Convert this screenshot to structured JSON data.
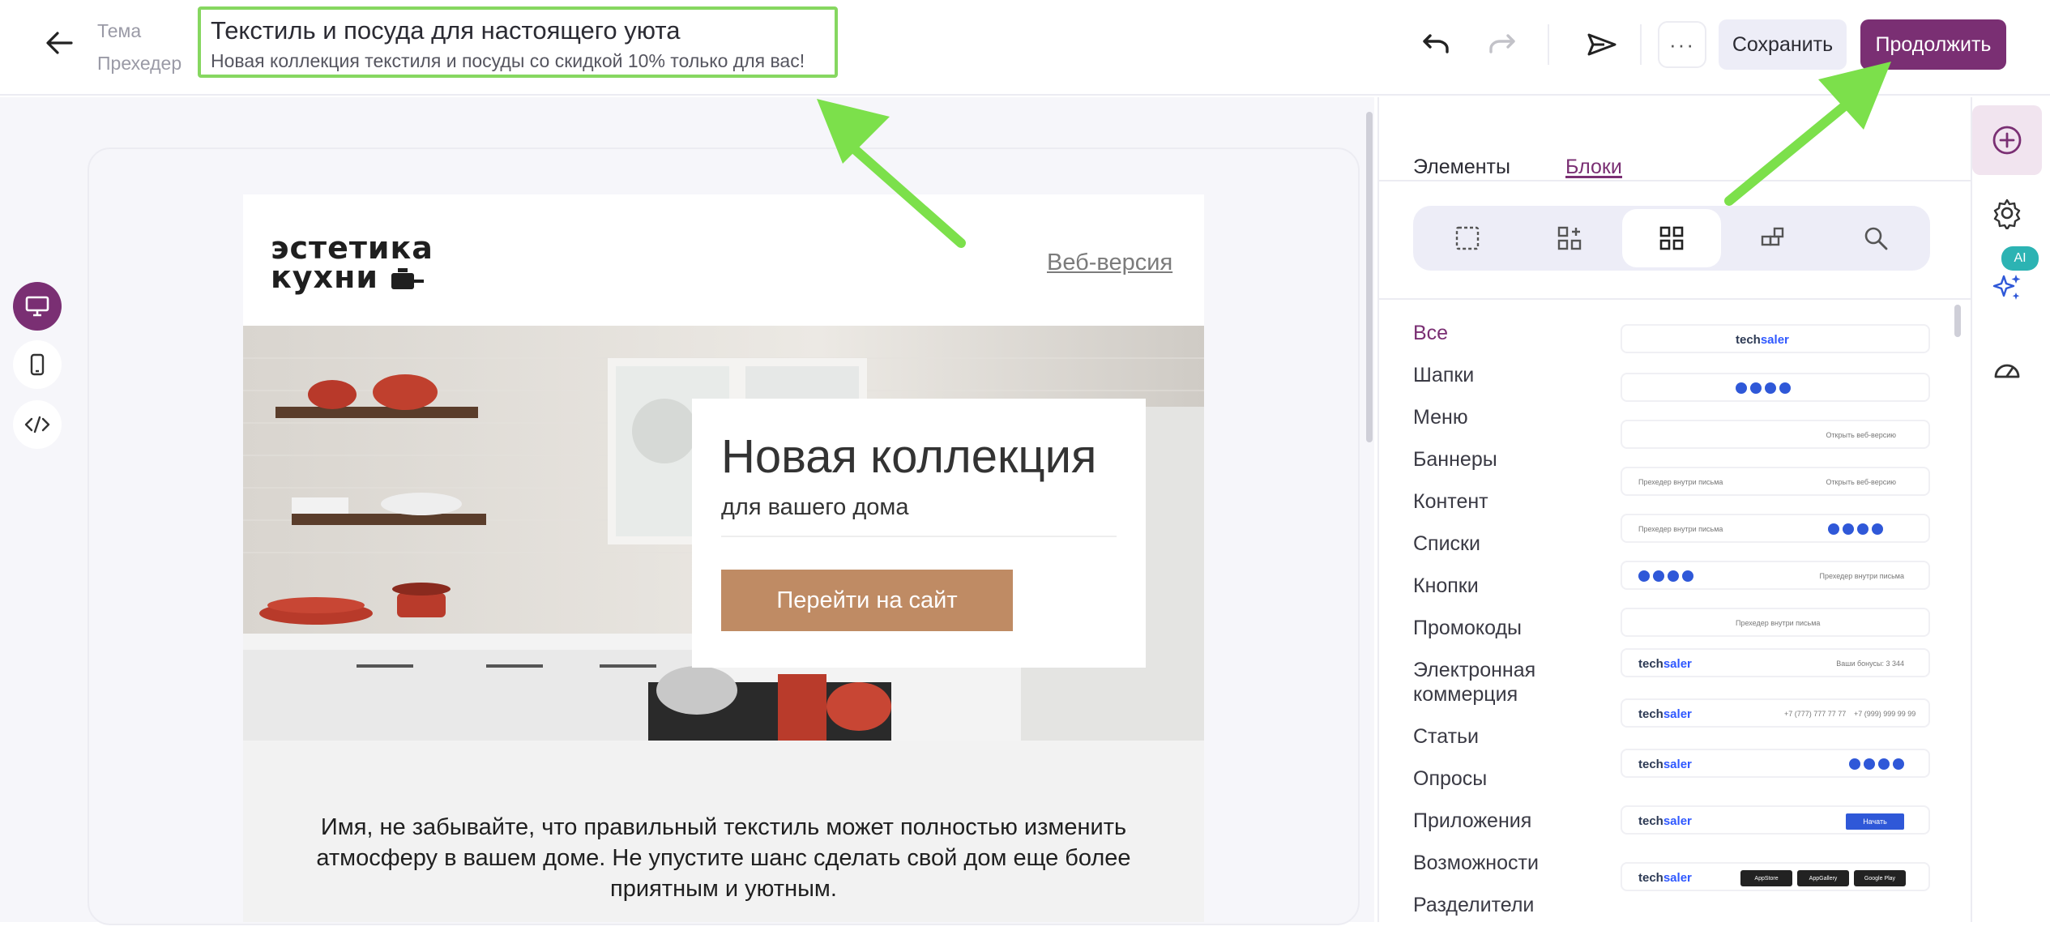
{
  "header": {
    "subject_label": "Тема",
    "preheader_label": "Прехедер",
    "subject": "Текстиль и посуда для настоящего уюта",
    "preheader": "Новая коллекция текстиля и посуды со скидкой 10% только для вас!",
    "more_label": "···",
    "save_label": "Сохранить",
    "continue_label": "Продолжить"
  },
  "email": {
    "logo_line1": "эстетика",
    "logo_line2": "кухни",
    "web_version": "Веб-версия",
    "banner_title": "Новая коллекция",
    "banner_subtitle": "для вашего дома",
    "banner_button": "Перейти на сайт",
    "body_text": "Имя, не забывайте, что правильный текстиль может полностью изменить атмосферу в вашем доме. Не упустите шанс сделать свой дом еще более приятным и уютным."
  },
  "panel": {
    "tabs": [
      {
        "label": "Элементы",
        "active": false
      },
      {
        "label": "Блоки",
        "active": true
      }
    ],
    "categories": [
      {
        "label": "Все",
        "active": true
      },
      {
        "label": "Шапки"
      },
      {
        "label": "Меню"
      },
      {
        "label": "Баннеры"
      },
      {
        "label": "Контент"
      },
      {
        "label": "Списки"
      },
      {
        "label": "Кнопки"
      },
      {
        "label": "Промокоды"
      },
      {
        "label": "Электронная коммерция"
      },
      {
        "label": "Статьи"
      },
      {
        "label": "Опросы"
      },
      {
        "label": "Приложения"
      },
      {
        "label": "Возможности"
      },
      {
        "label": "Разделители"
      }
    ],
    "thumbs": {
      "brand_a": "tech",
      "brand_b": "saler",
      "open_web": "Открыть веб-версию",
      "preheader_inside": "Прехедер внутри письма",
      "bonuses": "Ваши бонусы: 3 344",
      "phone1": "+7 (777) 777 77 77",
      "phone2": "+7 (999) 999 99 99",
      "start": "Начать",
      "store1": "AppStore",
      "store2": "AppGallery",
      "store3": "Google Play"
    }
  },
  "rail": {
    "ai_label": "AI"
  },
  "colors": {
    "accent": "#7a2f73",
    "highlight": "#86d760",
    "banner_button": "#bf8b64"
  },
  "icons": [
    "back-arrow-icon",
    "undo-icon",
    "redo-icon",
    "send-icon",
    "desktop-icon",
    "mobile-icon",
    "code-icon",
    "plus-circle-icon",
    "gear-icon",
    "sparkles-icon",
    "gauge-icon"
  ]
}
